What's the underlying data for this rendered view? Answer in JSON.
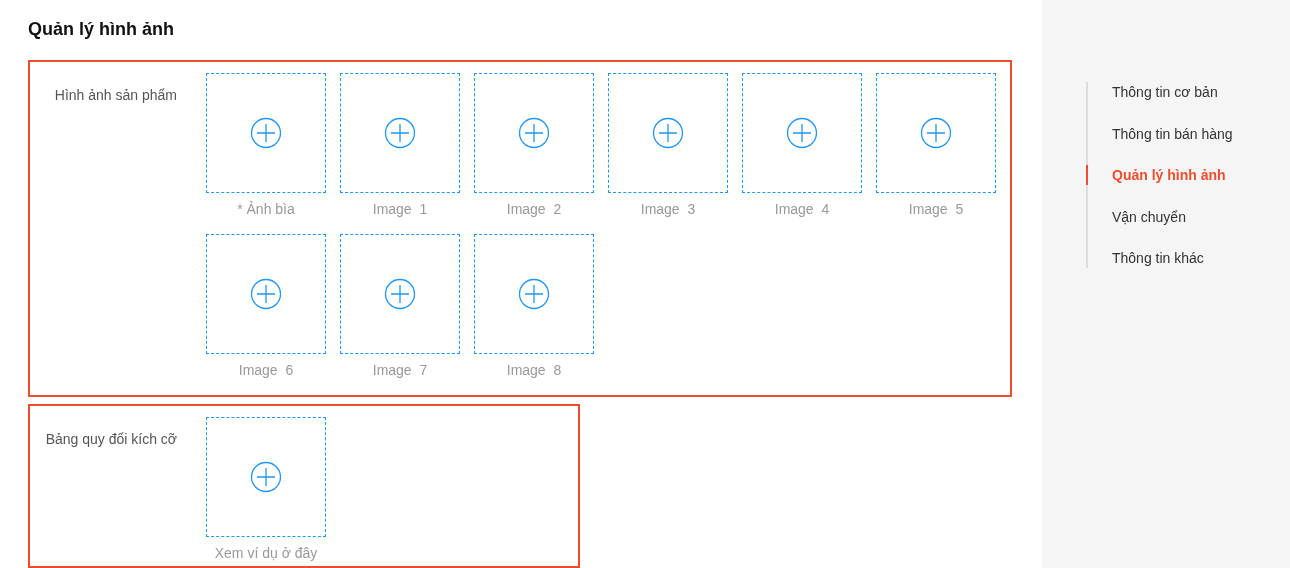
{
  "page_title": "Quản lý hình ảnh",
  "sections": [
    {
      "label": "Hình ảnh sản phẩm",
      "highlighted": true,
      "slots": [
        {
          "caption": "* Ảnh bìa"
        },
        {
          "caption": "Image  1"
        },
        {
          "caption": "Image  2"
        },
        {
          "caption": "Image  3"
        },
        {
          "caption": "Image  4"
        },
        {
          "caption": "Image  5"
        },
        {
          "caption": "Image  6"
        },
        {
          "caption": "Image  7"
        },
        {
          "caption": "Image  8"
        }
      ]
    },
    {
      "label": "Bảng quy đổi kích cỡ",
      "highlighted": true,
      "slots": [
        {
          "caption": "Xem ví dụ ở đây"
        }
      ]
    }
  ],
  "sidebar": {
    "items": [
      {
        "label": "Thông tin cơ bản",
        "selected": false
      },
      {
        "label": "Thông tin bán hàng",
        "selected": false
      },
      {
        "label": "Quản lý hình ảnh",
        "selected": true
      },
      {
        "label": "Vận chuyển",
        "selected": false
      },
      {
        "label": "Thông tin khác",
        "selected": false
      }
    ]
  }
}
